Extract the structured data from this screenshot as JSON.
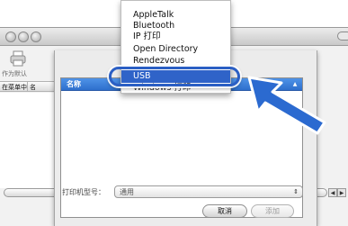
{
  "background_window": {
    "toolbar_label": "作为默认",
    "columns": [
      "在菜单中",
      "名"
    ]
  },
  "popup_menu": {
    "items": [
      {
        "label": "AppleTalk",
        "selected": false
      },
      {
        "label": "Bluetooth",
        "selected": false
      },
      {
        "label": "IP 打印",
        "selected": false
      },
      {
        "label": "Open Directory",
        "selected": false
      },
      {
        "label": "Rendezvous",
        "selected": false
      },
      {
        "label": "USB",
        "selected": true
      },
      {
        "label": "Windows 打印",
        "selected": false
      }
    ]
  },
  "sheet": {
    "table": {
      "columns": [
        "名称"
      ]
    },
    "printer_type": {
      "label": "打印机型号：",
      "value": "通用"
    },
    "buttons": {
      "cancel": "取消",
      "add": "添加"
    }
  },
  "colors": {
    "accent": "#2f63c8",
    "pointer": "#2b6ad0",
    "table_header": "#3d80dc"
  },
  "icons": [
    "printer-icon",
    "stepper-icon",
    "pointer-arrow-icon",
    "sort-indicator-icon"
  ]
}
